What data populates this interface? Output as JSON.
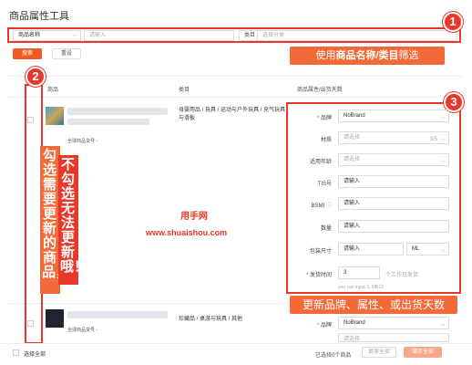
{
  "header": {
    "title": "商品属性工具"
  },
  "filter": {
    "field_select": "商品名称",
    "name_placeholder": "请输入",
    "category_label": "类目",
    "category_placeholder": "选择分类"
  },
  "buttons": {
    "search": "搜索",
    "reset": "重设"
  },
  "annotations": {
    "badge1": "1",
    "badge2": "2",
    "badge3": "3",
    "callout1_pre": "使用",
    "callout1_bold": "商品名称/类目",
    "callout1_post": "筛选",
    "vertical_right": "不勾选无法更新哦！",
    "vertical_left": "勾选需要更新的商品，",
    "callout3": "更新品牌、属性、或出货天数"
  },
  "table": {
    "headers": {
      "product": "商品",
      "category": "类目",
      "attrs": "商品属性/出货天数"
    },
    "rows": [
      {
        "sku_label": "全球商品货号 -",
        "category": "母婴用品 / 玩具 / 运动与户外玩具 / 充气玩具与滑板"
      },
      {
        "sku_label": "全球商品货号 -",
        "category": "珍藏品 / 桌游与玩具 / 其他"
      }
    ]
  },
  "form": {
    "brand_label": "品牌",
    "brand_value": "NoBrand",
    "material_label": "材质",
    "material_placeholder": "请选择",
    "material_count": "0/5",
    "age_label": "适用年龄",
    "age_placeholder": "请选择",
    "tis_label": "TIS号",
    "tis_placeholder": "请输入",
    "bsmi_label": "BSMI",
    "bsmi_placeholder": "请输入",
    "qty_label": "数量",
    "qty_placeholder": "请输入",
    "pkg_label": "包装尺寸",
    "pkg_placeholder": "请输入",
    "pkg_unit": "ML",
    "ship_label": "发货时间",
    "ship_value": "3",
    "ship_hint": "个工作日发货",
    "ship_range": "you can input 3, 5到10",
    "row2_brand_value": "NoBrand",
    "row2_placeholder": "请选择"
  },
  "watermark": {
    "line1": "用手网",
    "line2": "www.shuaishou.com"
  },
  "footer": {
    "select_all": "选择全部",
    "selected_count": "已选择0个商品",
    "restore_all": "复原全部",
    "save_all": "储存全部"
  },
  "colors": {
    "accent": "#f15a24",
    "annotation": "#e8372b"
  }
}
